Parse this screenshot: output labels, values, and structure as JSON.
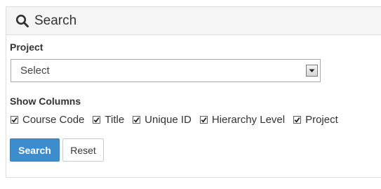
{
  "header": {
    "title": "Search",
    "icon": "search-icon"
  },
  "project": {
    "label": "Project",
    "selected": "Select"
  },
  "show_columns": {
    "label": "Show Columns",
    "options": [
      {
        "label": "Course Code",
        "checked": true
      },
      {
        "label": "Title",
        "checked": true
      },
      {
        "label": "Unique ID",
        "checked": true
      },
      {
        "label": "Hierarchy Level",
        "checked": true
      },
      {
        "label": "Project",
        "checked": true
      }
    ]
  },
  "actions": {
    "search_label": "Search",
    "reset_label": "Reset"
  },
  "colors": {
    "primary": "#3d8ccd",
    "heading_bg": "#f5f5f5",
    "border": "#dddddd"
  }
}
